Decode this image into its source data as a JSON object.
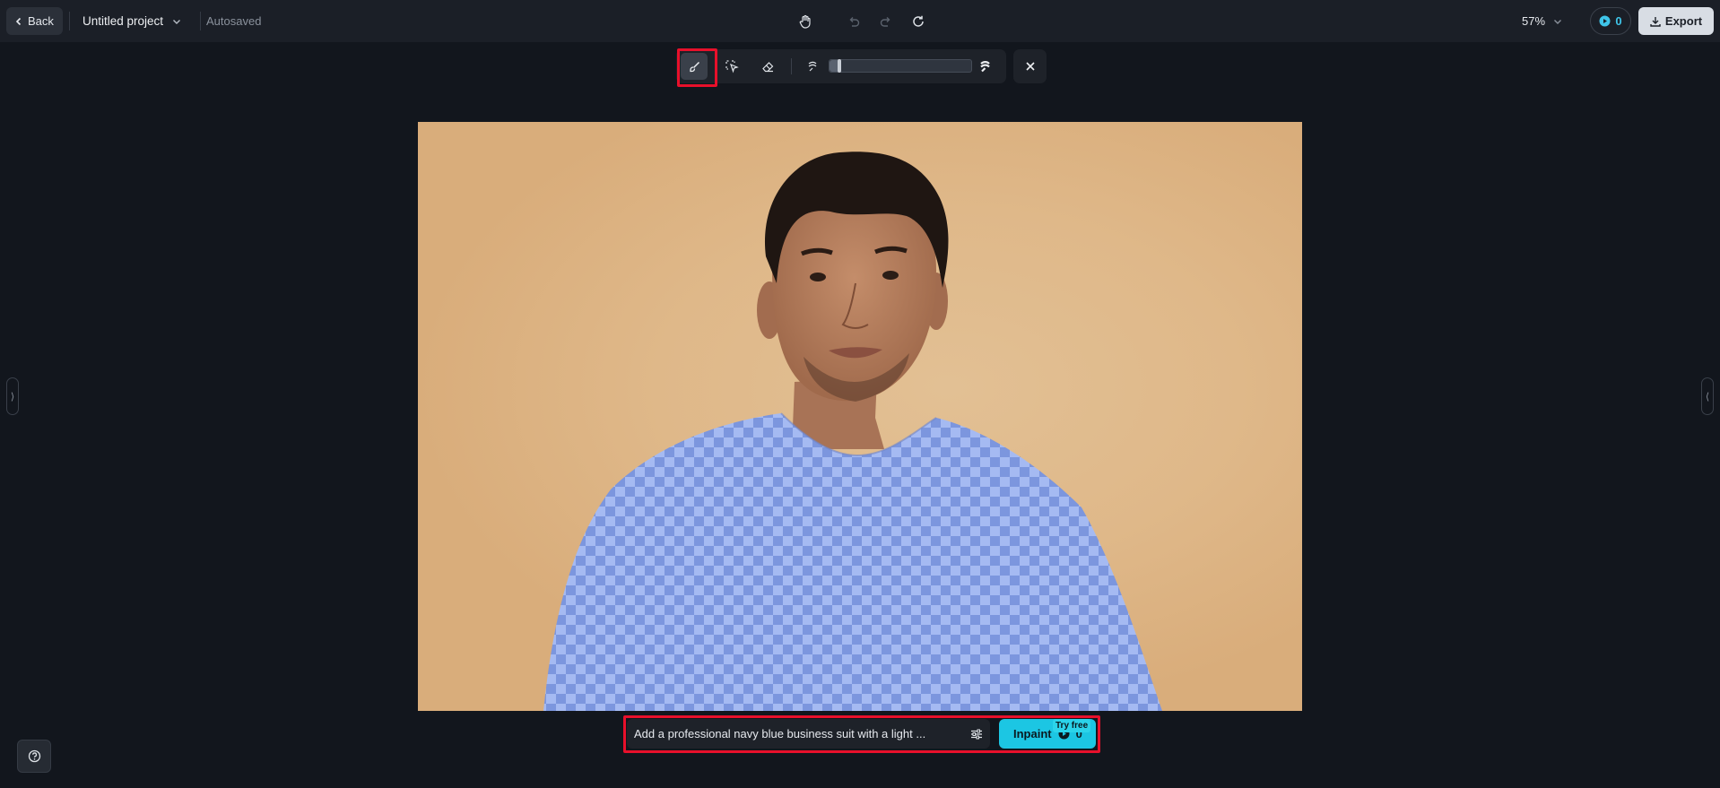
{
  "header": {
    "back_label": "Back",
    "project_title": "Untitled project",
    "autosave_status": "Autosaved",
    "zoom_level": "57%",
    "credits": "0",
    "export_label": "Export"
  },
  "brush_toolbar": {
    "tools": [
      "brush-icon",
      "lasso-select-icon",
      "eraser-icon"
    ],
    "brush_size_fraction": 0.06
  },
  "prompt": {
    "value": "Add a professional navy blue business suit with a light ...",
    "action_label": "Inpaint",
    "action_cost": "0",
    "badge": "Try free"
  },
  "colors": {
    "accent": "#1cc6e3",
    "highlight": "#e8102b",
    "mask": "#8aa8f0",
    "background": "#12161d"
  }
}
